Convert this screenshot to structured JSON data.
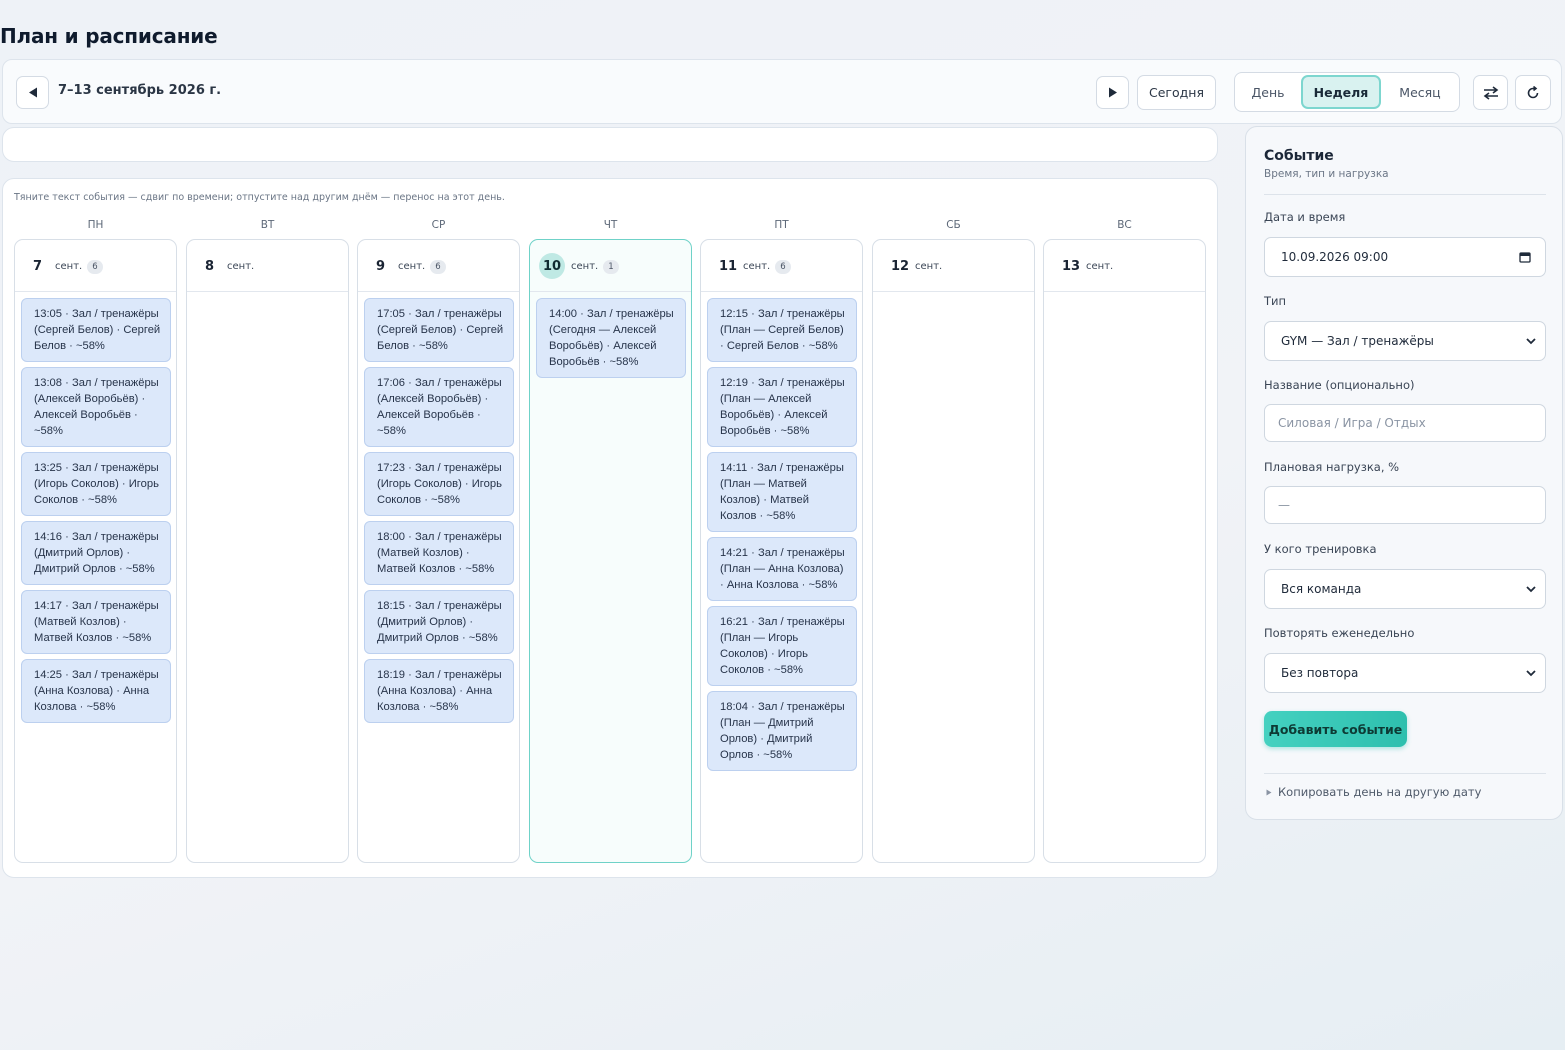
{
  "page": {
    "title": "План и расписание"
  },
  "toolbar": {
    "prev_icon": "triangle-left-icon",
    "date_range": "7–13 сентябрь 2026 г.",
    "next_icon": "triangle-right-icon",
    "today_label": "Сегодня",
    "views": [
      "День",
      "Неделя",
      "Месяц"
    ],
    "active_view": "Неделя",
    "swap_icon": "swap-arrows-icon",
    "refresh_icon": "refresh-icon"
  },
  "calendar": {
    "hint": "Тяните текст события — сдвиг по времени; отпустите над другим днём — перенос на этот день.",
    "weekdays": [
      "ПН",
      "ВТ",
      "СР",
      "ЧТ",
      "ПТ",
      "СБ",
      "ВС"
    ],
    "days": [
      {
        "num": "7",
        "mon": "сент.",
        "count": "6",
        "today": false,
        "events": [
          "13:05 · Зал / тренажёры (Сергей Белов) · Сергей Белов · ~58%",
          "13:08 · Зал / тренажёры (Алексей Воробьёв) · Алексей Воробьёв · ~58%",
          "13:25 · Зал / тренажёры (Игорь Соколов) · Игорь Соколов · ~58%",
          "14:16 · Зал / тренажёры (Дмитрий Орлов) · Дмитрий Орлов · ~58%",
          "14:17 · Зал / тренажёры (Матвей Козлов) · Матвей Козлов · ~58%",
          "14:25 · Зал / тренажёры (Анна Козлова) · Анна Козлова · ~58%"
        ]
      },
      {
        "num": "8",
        "mon": "сент.",
        "count": "",
        "today": false,
        "events": []
      },
      {
        "num": "9",
        "mon": "сент.",
        "count": "6",
        "today": false,
        "events": [
          "17:05 · Зал / тренажёры (Сергей Белов) · Сергей Белов · ~58%",
          "17:06 · Зал / тренажёры (Алексей Воробьёв) · Алексей Воробьёв · ~58%",
          "17:23 · Зал / тренажёры (Игорь Соколов) · Игорь Соколов · ~58%",
          "18:00 · Зал / тренажёры (Матвей Козлов) · Матвей Козлов · ~58%",
          "18:15 · Зал / тренажёры (Дмитрий Орлов) · Дмитрий Орлов · ~58%",
          "18:19 · Зал / тренажёры (Анна Козлова) · Анна Козлова · ~58%"
        ]
      },
      {
        "num": "10",
        "mon": "сент.",
        "count": "1",
        "today": true,
        "events": [
          "14:00 · Зал / тренажёры (Сегодня — Алексей Воробьёв) · Алексей Воробьёв · ~58%"
        ]
      },
      {
        "num": "11",
        "mon": "сент.",
        "count": "6",
        "today": false,
        "events": [
          "12:15 · Зал / тренажёры (План — Сергей Белов) · Сергей Белов · ~58%",
          "12:19 · Зал / тренажёры (План — Алексей Воробьёв) · Алексей Воробьёв · ~58%",
          "14:11 · Зал / тренажёры (План — Матвей Козлов) · Матвей Козлов · ~58%",
          "14:21 · Зал / тренажёры (План — Анна Козлова) · Анна Козлова · ~58%",
          "16:21 · Зал / тренажёры (План — Игорь Соколов) · Игорь Соколов · ~58%",
          "18:04 · Зал / тренажёры (План — Дмитрий Орлов) · Дмитрий Орлов · ~58%"
        ]
      },
      {
        "num": "12",
        "mon": "сент.",
        "count": "",
        "today": false,
        "events": []
      },
      {
        "num": "13",
        "mon": "сент.",
        "count": "",
        "today": false,
        "events": []
      }
    ]
  },
  "side": {
    "title": "Событие",
    "subtitle": "Время, тип и нагрузка",
    "datetime_label": "Дата и время",
    "datetime_value": "10.09.2026 09:00",
    "type_label": "Тип",
    "type_value": "GYM — Зал / тренажёры",
    "name_label": "Название (опционально)",
    "name_placeholder": "Силовая / Игра / Отдых",
    "load_label": "Плановая нагрузка, %",
    "load_placeholder": "—",
    "who_label": "У кого тренировка",
    "who_value": "Вся команда",
    "repeat_label": "Повторять еженедельно",
    "repeat_value": "Без повтора",
    "add_label": "Добавить событие",
    "copy_label": "Копировать день на другую дату"
  },
  "colors": {
    "accent": "#2ebfae",
    "event_bg": "#dce8fa",
    "today_border": "#6fd2c8"
  }
}
